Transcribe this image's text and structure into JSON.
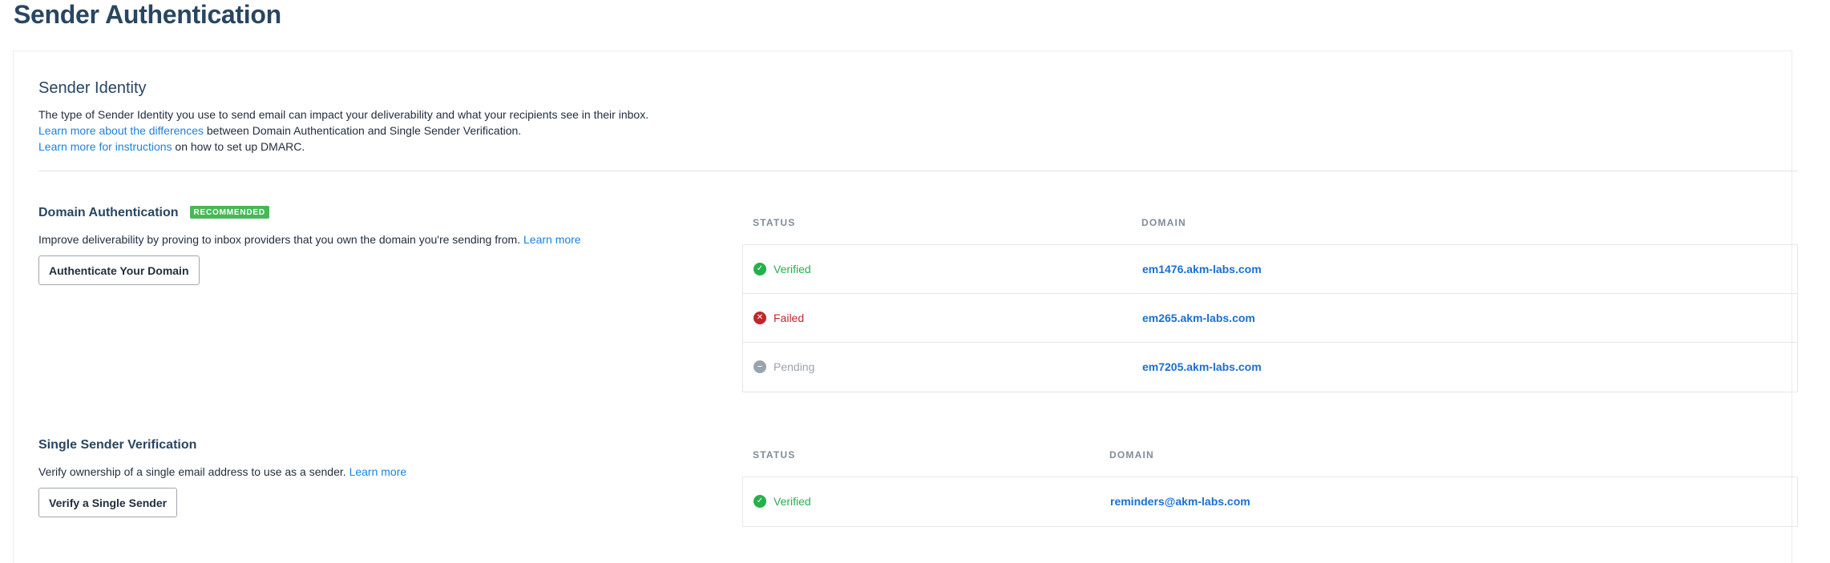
{
  "page": {
    "title": "Sender Authentication"
  },
  "sender_identity": {
    "title": "Sender Identity",
    "description": "The type of Sender Identity you use to send email can impact your deliverability and what your recipients see in their inbox.",
    "differences_link": "Learn more about the differences",
    "differences_text": " between Domain Authentication and Single Sender Verification.",
    "dmarc_link": "Learn more for instructions",
    "dmarc_text": " on how to set up DMARC."
  },
  "domain_auth": {
    "title": "Domain Authentication",
    "badge": "RECOMMENDED",
    "description": "Improve deliverability by proving to inbox providers that you own the domain you're sending from. ",
    "learn_more": "Learn more",
    "button": "Authenticate Your Domain",
    "columns": {
      "status": "STATUS",
      "domain": "DOMAIN"
    },
    "rows": [
      {
        "status": "Verified",
        "domain": "em1476.akm-labs.com"
      },
      {
        "status": "Failed",
        "domain": "em265.akm-labs.com"
      },
      {
        "status": "Pending",
        "domain": "em7205.akm-labs.com"
      }
    ]
  },
  "single_sender": {
    "title": "Single Sender Verification",
    "description": "Verify ownership of a single email address to use as a sender. ",
    "learn_more": "Learn more",
    "button": "Verify a Single Sender",
    "columns": {
      "status": "STATUS",
      "domain": "DOMAIN"
    },
    "rows": [
      {
        "status": "Verified",
        "domain": "reminders@akm-labs.com"
      }
    ]
  },
  "icons": {
    "verified": "check-circle-icon",
    "failed": "x-circle-icon",
    "pending": "minus-circle-icon"
  },
  "colors": {
    "verified": "#23b14d",
    "failed": "#c0272d",
    "pending": "#9aa4ad",
    "link": "#1a82e2",
    "badge": "#48b856"
  }
}
